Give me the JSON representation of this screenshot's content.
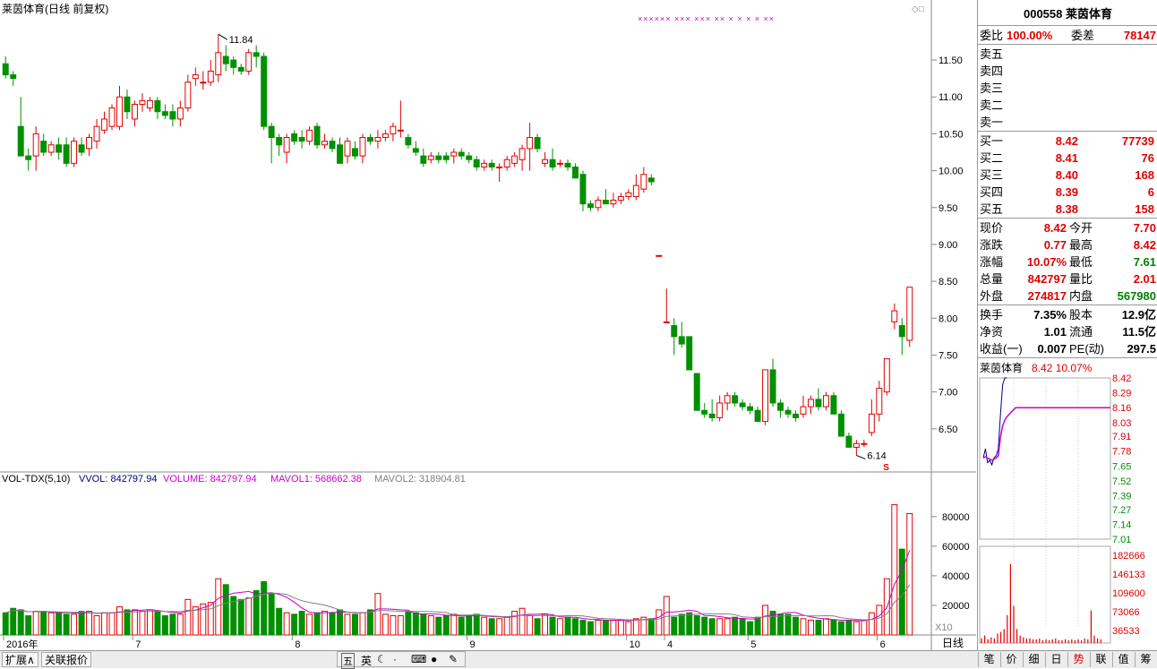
{
  "chart_title": "莱茵体育(日线 前复权)",
  "chart_data": [
    {
      "type": "candlestick",
      "title": "莱茵体育(日线 前复权)",
      "y_ticks": [
        "11.50",
        "11.00",
        "10.50",
        "10.00",
        "9.50",
        "9.00",
        "8.50",
        "8.00",
        "7.50",
        "7.00",
        "6.50"
      ],
      "y_range": [
        6.0,
        11.95
      ],
      "x_ticks": [
        "2016年",
        "7",
        "8",
        "9",
        "10",
        "4",
        "5",
        "6"
      ],
      "annotations": [
        "11.84",
        "6.14"
      ],
      "candles": [
        {
          "o": 11.45,
          "h": 11.55,
          "l": 11.25,
          "c": 11.3
        },
        {
          "o": 11.3,
          "h": 11.35,
          "l": 11.15,
          "c": 11.25
        },
        {
          "o": 10.6,
          "h": 11.0,
          "l": 10.2,
          "c": 10.2
        },
        {
          "o": 10.2,
          "h": 10.3,
          "l": 10.0,
          "c": 10.15
        },
        {
          "o": 10.2,
          "h": 10.6,
          "l": 10.0,
          "c": 10.5
        },
        {
          "o": 10.4,
          "h": 10.5,
          "l": 10.2,
          "c": 10.25
        },
        {
          "o": 10.25,
          "h": 10.4,
          "l": 10.2,
          "c": 10.35
        },
        {
          "o": 10.35,
          "h": 10.45,
          "l": 10.15,
          "c": 10.25
        },
        {
          "o": 10.35,
          "h": 10.45,
          "l": 10.05,
          "c": 10.1
        },
        {
          "o": 10.1,
          "h": 10.45,
          "l": 10.05,
          "c": 10.4
        },
        {
          "o": 10.35,
          "h": 10.45,
          "l": 10.2,
          "c": 10.25
        },
        {
          "o": 10.3,
          "h": 10.5,
          "l": 10.2,
          "c": 10.45
        },
        {
          "o": 10.4,
          "h": 10.7,
          "l": 10.3,
          "c": 10.6
        },
        {
          "o": 10.55,
          "h": 10.8,
          "l": 10.5,
          "c": 10.7
        },
        {
          "o": 10.6,
          "h": 10.9,
          "l": 10.55,
          "c": 10.85
        },
        {
          "o": 10.6,
          "h": 11.15,
          "l": 10.55,
          "c": 11.0
        },
        {
          "o": 11.0,
          "h": 11.1,
          "l": 10.7,
          "c": 10.8
        },
        {
          "o": 10.7,
          "h": 10.95,
          "l": 10.6,
          "c": 10.9
        },
        {
          "o": 10.9,
          "h": 11.05,
          "l": 10.8,
          "c": 10.95
        },
        {
          "o": 10.85,
          "h": 11.0,
          "l": 10.8,
          "c": 10.95
        },
        {
          "o": 10.95,
          "h": 11.0,
          "l": 10.7,
          "c": 10.8
        },
        {
          "o": 10.8,
          "h": 10.9,
          "l": 10.7,
          "c": 10.75
        },
        {
          "o": 10.8,
          "h": 10.9,
          "l": 10.6,
          "c": 10.7
        },
        {
          "o": 10.7,
          "h": 10.95,
          "l": 10.6,
          "c": 10.85
        },
        {
          "o": 10.85,
          "h": 11.3,
          "l": 10.8,
          "c": 11.2
        },
        {
          "o": 11.25,
          "h": 11.4,
          "l": 11.15,
          "c": 11.3
        },
        {
          "o": 11.2,
          "h": 11.35,
          "l": 11.1,
          "c": 11.2
        },
        {
          "o": 11.2,
          "h": 11.5,
          "l": 11.15,
          "c": 11.35
        },
        {
          "o": 11.3,
          "h": 11.85,
          "l": 11.2,
          "c": 11.6
        },
        {
          "o": 11.55,
          "h": 11.7,
          "l": 11.35,
          "c": 11.45
        },
        {
          "o": 11.5,
          "h": 11.55,
          "l": 11.3,
          "c": 11.4
        },
        {
          "o": 11.4,
          "h": 11.45,
          "l": 11.3,
          "c": 11.35
        },
        {
          "o": 11.35,
          "h": 11.65,
          "l": 11.3,
          "c": 11.6
        },
        {
          "o": 11.6,
          "h": 11.7,
          "l": 11.4,
          "c": 11.55
        },
        {
          "o": 11.55,
          "h": 11.6,
          "l": 10.55,
          "c": 10.6
        },
        {
          "o": 10.6,
          "h": 10.65,
          "l": 10.1,
          "c": 10.45
        },
        {
          "o": 10.45,
          "h": 10.5,
          "l": 10.2,
          "c": 10.35
        },
        {
          "o": 10.25,
          "h": 10.5,
          "l": 10.1,
          "c": 10.45
        },
        {
          "o": 10.5,
          "h": 10.55,
          "l": 10.35,
          "c": 10.4
        },
        {
          "o": 10.45,
          "h": 10.55,
          "l": 10.3,
          "c": 10.4
        },
        {
          "o": 10.4,
          "h": 10.6,
          "l": 10.35,
          "c": 10.55
        },
        {
          "o": 10.6,
          "h": 10.65,
          "l": 10.3,
          "c": 10.35
        },
        {
          "o": 10.35,
          "h": 10.5,
          "l": 10.3,
          "c": 10.4
        },
        {
          "o": 10.4,
          "h": 10.45,
          "l": 10.25,
          "c": 10.3
        },
        {
          "o": 10.35,
          "h": 10.45,
          "l": 10.1,
          "c": 10.1
        },
        {
          "o": 10.2,
          "h": 10.45,
          "l": 10.1,
          "c": 10.4
        },
        {
          "o": 10.3,
          "h": 10.4,
          "l": 10.15,
          "c": 10.2
        },
        {
          "o": 10.2,
          "h": 10.5,
          "l": 10.1,
          "c": 10.45
        },
        {
          "o": 10.45,
          "h": 10.5,
          "l": 10.35,
          "c": 10.4
        },
        {
          "o": 10.4,
          "h": 10.55,
          "l": 10.3,
          "c": 10.45
        },
        {
          "o": 10.45,
          "h": 10.55,
          "l": 10.4,
          "c": 10.5
        },
        {
          "o": 10.5,
          "h": 10.65,
          "l": 10.4,
          "c": 10.6
        },
        {
          "o": 10.55,
          "h": 10.95,
          "l": 10.45,
          "c": 10.55
        },
        {
          "o": 10.45,
          "h": 10.5,
          "l": 10.3,
          "c": 10.35
        },
        {
          "o": 10.3,
          "h": 10.4,
          "l": 10.2,
          "c": 10.25
        },
        {
          "o": 10.2,
          "h": 10.3,
          "l": 10.05,
          "c": 10.1
        },
        {
          "o": 10.15,
          "h": 10.25,
          "l": 10.1,
          "c": 10.2
        },
        {
          "o": 10.2,
          "h": 10.25,
          "l": 10.1,
          "c": 10.15
        },
        {
          "o": 10.2,
          "h": 10.25,
          "l": 10.1,
          "c": 10.15
        },
        {
          "o": 10.2,
          "h": 10.3,
          "l": 10.1,
          "c": 10.25
        },
        {
          "o": 10.25,
          "h": 10.3,
          "l": 10.15,
          "c": 10.2
        },
        {
          "o": 10.2,
          "h": 10.25,
          "l": 10.1,
          "c": 10.15
        },
        {
          "o": 10.15,
          "h": 10.2,
          "l": 10.0,
          "c": 10.05
        },
        {
          "o": 10.05,
          "h": 10.15,
          "l": 10.0,
          "c": 10.1
        },
        {
          "o": 10.1,
          "h": 10.15,
          "l": 10.0,
          "c": 10.05
        },
        {
          "o": 10.05,
          "h": 10.1,
          "l": 9.85,
          "c": 10.05
        },
        {
          "o": 10.05,
          "h": 10.2,
          "l": 10.0,
          "c": 10.15
        },
        {
          "o": 10.1,
          "h": 10.25,
          "l": 10.05,
          "c": 10.2
        },
        {
          "o": 10.15,
          "h": 10.35,
          "l": 10.0,
          "c": 10.3
        },
        {
          "o": 10.3,
          "h": 10.65,
          "l": 10.0,
          "c": 10.45
        },
        {
          "o": 10.45,
          "h": 10.5,
          "l": 10.25,
          "c": 10.3
        },
        {
          "o": 10.1,
          "h": 10.25,
          "l": 10.05,
          "c": 10.15
        },
        {
          "o": 10.15,
          "h": 10.3,
          "l": 10.0,
          "c": 10.05
        },
        {
          "o": 10.1,
          "h": 10.15,
          "l": 10.05,
          "c": 10.1
        },
        {
          "o": 10.1,
          "h": 10.15,
          "l": 10.0,
          "c": 10.05
        },
        {
          "o": 10.05,
          "h": 10.1,
          "l": 9.9,
          "c": 9.9
        },
        {
          "o": 9.95,
          "h": 10.0,
          "l": 9.45,
          "c": 9.55
        },
        {
          "o": 9.55,
          "h": 9.6,
          "l": 9.45,
          "c": 9.5
        },
        {
          "o": 9.5,
          "h": 9.65,
          "l": 9.45,
          "c": 9.6
        },
        {
          "o": 9.6,
          "h": 9.75,
          "l": 9.55,
          "c": 9.55
        },
        {
          "o": 9.55,
          "h": 9.7,
          "l": 9.5,
          "c": 9.6
        },
        {
          "o": 9.6,
          "h": 9.7,
          "l": 9.55,
          "c": 9.65
        },
        {
          "o": 9.65,
          "h": 9.75,
          "l": 9.6,
          "c": 9.7
        },
        {
          "o": 9.65,
          "h": 9.95,
          "l": 9.6,
          "c": 9.8
        },
        {
          "o": 9.75,
          "h": 10.05,
          "l": 9.7,
          "c": 9.95
        },
        {
          "o": 9.9,
          "h": 9.95,
          "l": 9.8,
          "c": 9.85
        },
        {
          "o": 8.85,
          "h": 8.85,
          "l": 8.85,
          "c": 8.85
        },
        {
          "o": 7.95,
          "h": 8.4,
          "l": 7.95,
          "c": 7.95
        },
        {
          "o": 7.9,
          "h": 8.0,
          "l": 7.5,
          "c": 7.75
        },
        {
          "o": 7.75,
          "h": 7.95,
          "l": 7.6,
          "c": 7.65
        },
        {
          "o": 7.75,
          "h": 7.75,
          "l": 7.3,
          "c": 7.3
        },
        {
          "o": 7.25,
          "h": 7.25,
          "l": 6.75,
          "c": 6.75
        },
        {
          "o": 6.75,
          "h": 6.85,
          "l": 6.65,
          "c": 6.7
        },
        {
          "o": 6.7,
          "h": 6.9,
          "l": 6.6,
          "c": 6.65
        },
        {
          "o": 6.65,
          "h": 6.95,
          "l": 6.6,
          "c": 6.85
        },
        {
          "o": 6.85,
          "h": 7.0,
          "l": 6.75,
          "c": 6.95
        },
        {
          "o": 6.95,
          "h": 7.0,
          "l": 6.8,
          "c": 6.85
        },
        {
          "o": 6.85,
          "h": 6.9,
          "l": 6.75,
          "c": 6.8
        },
        {
          "o": 6.8,
          "h": 6.85,
          "l": 6.7,
          "c": 6.75
        },
        {
          "o": 6.75,
          "h": 6.8,
          "l": 6.6,
          "c": 6.6
        },
        {
          "o": 6.6,
          "h": 7.3,
          "l": 6.55,
          "c": 7.3
        },
        {
          "o": 7.3,
          "h": 7.45,
          "l": 6.8,
          "c": 6.85
        },
        {
          "o": 6.85,
          "h": 6.9,
          "l": 6.65,
          "c": 6.75
        },
        {
          "o": 6.75,
          "h": 6.8,
          "l": 6.65,
          "c": 6.7
        },
        {
          "o": 6.7,
          "h": 6.75,
          "l": 6.6,
          "c": 6.65
        },
        {
          "o": 6.7,
          "h": 6.95,
          "l": 6.65,
          "c": 6.8
        },
        {
          "o": 6.8,
          "h": 6.95,
          "l": 6.7,
          "c": 6.9
        },
        {
          "o": 6.9,
          "h": 7.05,
          "l": 6.75,
          "c": 6.8
        },
        {
          "o": 6.8,
          "h": 7.0,
          "l": 6.75,
          "c": 6.95
        },
        {
          "o": 6.95,
          "h": 7.0,
          "l": 6.7,
          "c": 6.7
        },
        {
          "o": 6.7,
          "h": 6.75,
          "l": 6.4,
          "c": 6.4
        },
        {
          "o": 6.4,
          "h": 6.45,
          "l": 6.25,
          "c": 6.25
        },
        {
          "o": 6.25,
          "h": 6.35,
          "l": 6.14,
          "c": 6.3
        },
        {
          "o": 6.3,
          "h": 6.35,
          "l": 6.25,
          "c": 6.3
        },
        {
          "o": 6.45,
          "h": 6.9,
          "l": 6.4,
          "c": 6.7
        },
        {
          "o": 6.7,
          "h": 7.15,
          "l": 6.6,
          "c": 7.05
        },
        {
          "o": 7.0,
          "h": 7.45,
          "l": 6.95,
          "c": 7.45
        },
        {
          "o": 7.95,
          "h": 8.2,
          "l": 7.85,
          "c": 8.1
        },
        {
          "o": 7.9,
          "h": 8.0,
          "l": 7.5,
          "c": 7.75
        },
        {
          "o": 7.7,
          "h": 8.42,
          "l": 7.61,
          "c": 8.42
        }
      ]
    },
    {
      "type": "bar",
      "title": "VOL-TDX(5,10)",
      "y_ticks": [
        "80000",
        "60000",
        "40000",
        "20000"
      ],
      "y_range": [
        0,
        95000
      ],
      "series": [
        {
          "name": "VOLUME"
        },
        {
          "name": "MAVOL1"
        },
        {
          "name": "MAVOL2"
        }
      ],
      "volumes": [
        15000,
        18000,
        17000,
        13000,
        16000,
        16000,
        15000,
        15000,
        14000,
        14000,
        16000,
        16000,
        13000,
        15000,
        15000,
        19000,
        17000,
        17000,
        16000,
        17000,
        16000,
        13000,
        14000,
        14000,
        24000,
        19000,
        21000,
        22000,
        38000,
        34000,
        26000,
        24000,
        25000,
        30000,
        36000,
        28000,
        18000,
        15000,
        14000,
        16000,
        14000,
        15000,
        16000,
        15000,
        17000,
        14000,
        14000,
        15000,
        17000,
        28000,
        14000,
        13000,
        13000,
        16000,
        15000,
        14000,
        13000,
        12000,
        13000,
        14000,
        12000,
        13000,
        14000,
        12000,
        11000,
        11000,
        12000,
        16000,
        18000,
        13000,
        11000,
        14000,
        12000,
        11000,
        12000,
        11000,
        10000,
        9000,
        10000,
        10000,
        10000,
        10000,
        9000,
        11000,
        12000,
        11000,
        17000,
        26000,
        12000,
        14000,
        15000,
        13000,
        12000,
        11000,
        11000,
        11000,
        12000,
        11000,
        9000,
        12000,
        20000,
        16000,
        14000,
        14000,
        12000,
        11000,
        10000,
        10000,
        11000,
        10000,
        9000,
        10000,
        9000,
        10000,
        15000,
        20000,
        38000,
        88000,
        58000,
        82000
      ],
      "labels": {
        "tdx": "VOL-TDX(5,10)",
        "vvol": "VVOL: 842797.94",
        "volume": "VOLUME: 842797.94",
        "mavol1": "MAVOL1: 568662.38",
        "mavol2": "MAVOL2: 318904.81"
      },
      "x10": "X10"
    },
    {
      "type": "line",
      "title": "莱茵体育 8.42 10.07%",
      "y_ticks_right": [
        "8.42",
        "8.29",
        "8.16",
        "8.03",
        "7.91",
        "7.78",
        "7.65",
        "7.52",
        "7.39",
        "7.27",
        "7.14",
        "7.01"
      ],
      "vol_ticks": [
        "182666",
        "146133",
        "109600",
        "73066",
        "36533"
      ],
      "y_range": [
        7.01,
        8.42
      ],
      "prices": [
        7.72,
        7.8,
        7.68,
        7.7,
        7.66,
        7.72,
        7.74,
        7.8,
        8.1,
        8.36,
        8.42,
        8.42
      ]
    }
  ],
  "markers_top": "×××××× ××× ××× ×× × × × × ××",
  "s_marker": "S",
  "quote": {
    "code": "000558",
    "name": "莱茵体育",
    "weibi_label": "委比",
    "weibi": "100.00%",
    "weicha_label": "委差",
    "weicha": "78147",
    "sells": [
      "卖五",
      "卖四",
      "卖三",
      "卖二",
      "卖一"
    ],
    "buys": [
      {
        "label": "买一",
        "price": "8.42",
        "qty": "77739"
      },
      {
        "label": "买二",
        "price": "8.41",
        "qty": "76"
      },
      {
        "label": "买三",
        "price": "8.40",
        "qty": "168"
      },
      {
        "label": "买四",
        "price": "8.39",
        "qty": "6"
      },
      {
        "label": "买五",
        "price": "8.38",
        "qty": "158"
      }
    ],
    "stats": [
      [
        {
          "l": "现价",
          "v": "8.42",
          "c": "red"
        },
        {
          "l": "今开",
          "v": "7.70",
          "c": "red"
        }
      ],
      [
        {
          "l": "涨跌",
          "v": "0.77",
          "c": "red"
        },
        {
          "l": "最高",
          "v": "8.42",
          "c": "red"
        }
      ],
      [
        {
          "l": "涨幅",
          "v": "10.07%",
          "c": "red"
        },
        {
          "l": "最低",
          "v": "7.61",
          "c": "grn"
        }
      ],
      [
        {
          "l": "总量",
          "v": "842797",
          "c": "red"
        },
        {
          "l": "量比",
          "v": "2.01",
          "c": "red"
        }
      ],
      [
        {
          "l": "外盘",
          "v": "274817",
          "c": "red"
        },
        {
          "l": "内盘",
          "v": "567980",
          "c": "grn"
        }
      ]
    ],
    "stats2": [
      [
        {
          "l": "换手",
          "v": "7.35%"
        },
        {
          "l": "股本",
          "v": "12.9亿"
        }
      ],
      [
        {
          "l": "净资",
          "v": "1.01"
        },
        {
          "l": "流通",
          "v": "11.5亿"
        }
      ],
      [
        {
          "l": "收益(一)",
          "v": "0.007"
        },
        {
          "l": "PE(动)",
          "v": "297.5"
        }
      ]
    ]
  },
  "period_label": "日线",
  "bottom_tabs": [
    "扩展∧",
    "关联报价"
  ],
  "toolbar_icons": [
    "五",
    "英",
    "moon-icon",
    "·",
    "keyboard-icon",
    "user-icon",
    "wrench-icon"
  ],
  "right_tabs": [
    "笔",
    "价",
    "细",
    "日",
    "势",
    "联",
    "值",
    "筹"
  ],
  "colors": {
    "up": "#e00000",
    "down": "#009000",
    "ma1": "#cc00cc",
    "ma2": "#808080",
    "axis": "#888888"
  }
}
